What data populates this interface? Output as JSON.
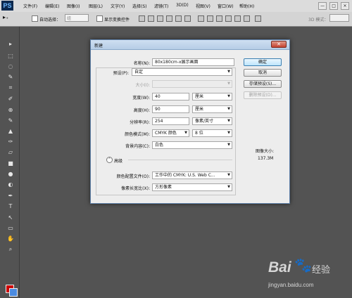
{
  "app": {
    "logo": "PS"
  },
  "menubar": {
    "items": [
      "文件(F)",
      "编辑(E)",
      "图像(I)",
      "图层(L)",
      "文字(Y)",
      "选择(S)",
      "滤镜(T)",
      "3D(D)",
      "视图(V)",
      "窗口(W)",
      "帮助(H)"
    ],
    "window_buttons": [
      "—",
      "□",
      "×"
    ]
  },
  "options_bar": {
    "auto_select_label": "自动选择：",
    "auto_select_value": "组",
    "show_transform_label": "显示变换控件",
    "mode_label": "3D 模式："
  },
  "toolbar": {
    "icons": [
      "move-icon",
      "marquee-icon",
      "lasso-icon",
      "quick-select-icon",
      "crop-icon",
      "eyedropper-icon",
      "healing-icon",
      "brush-icon",
      "stamp-icon",
      "history-brush-icon",
      "eraser-icon",
      "gradient-icon",
      "blur-icon",
      "dodge-icon",
      "pen-icon",
      "type-icon",
      "path-select-icon",
      "shape-icon",
      "hand-icon",
      "zoom-icon"
    ],
    "glyphs": [
      "▸",
      "⬚",
      "◌",
      "✎",
      "⌗",
      "✐",
      "⊕",
      "✎",
      "▲",
      "✑",
      "▱",
      "■",
      "●",
      "◐",
      "✒",
      "T",
      "↖",
      "▭",
      "✋",
      "⌕"
    ],
    "fg_color": "#cc0000",
    "bg_color": "#4b8be0"
  },
  "dialog": {
    "title": "新建",
    "close": "✕",
    "name_label": "名称(N):",
    "name_value": "80x180cm-x展示画面",
    "preset_label": "预设(P):",
    "preset_value": "自定",
    "size_label": "大小(I):",
    "size_value": "",
    "width_label": "宽度(W):",
    "width_value": "40",
    "width_unit": "厘米",
    "height_label": "高度(H):",
    "height_value": "90",
    "height_unit": "厘米",
    "resolution_label": "分辨率(R):",
    "resolution_value": "254",
    "resolution_unit": "像素/英寸",
    "color_mode_label": "颜色模式(M):",
    "color_mode_value": "CMYK 颜色",
    "bit_depth_value": "8 位",
    "background_label": "背景内容(C):",
    "background_value": "白色",
    "advanced_label": "高级",
    "advanced_toggle": "⌃",
    "color_profile_label": "颜色配置文件(O):",
    "color_profile_value": "工作中的 CMYK: U.S. Web C...",
    "pixel_aspect_label": "像素长宽比(X):",
    "pixel_aspect_value": "方形像素",
    "ok_label": "确定",
    "cancel_label": "取消",
    "save_preset_label": "存储预设(S)...",
    "delete_preset_label": "删除预设(D)...",
    "image_size_label": "图像大小:",
    "image_size_value": "137.3M",
    "arrow": "▼"
  },
  "watermark": {
    "bai": "Bai",
    "paw": "🐾",
    "jingyan": "经验",
    "url": "jingyan.baidu.com"
  }
}
